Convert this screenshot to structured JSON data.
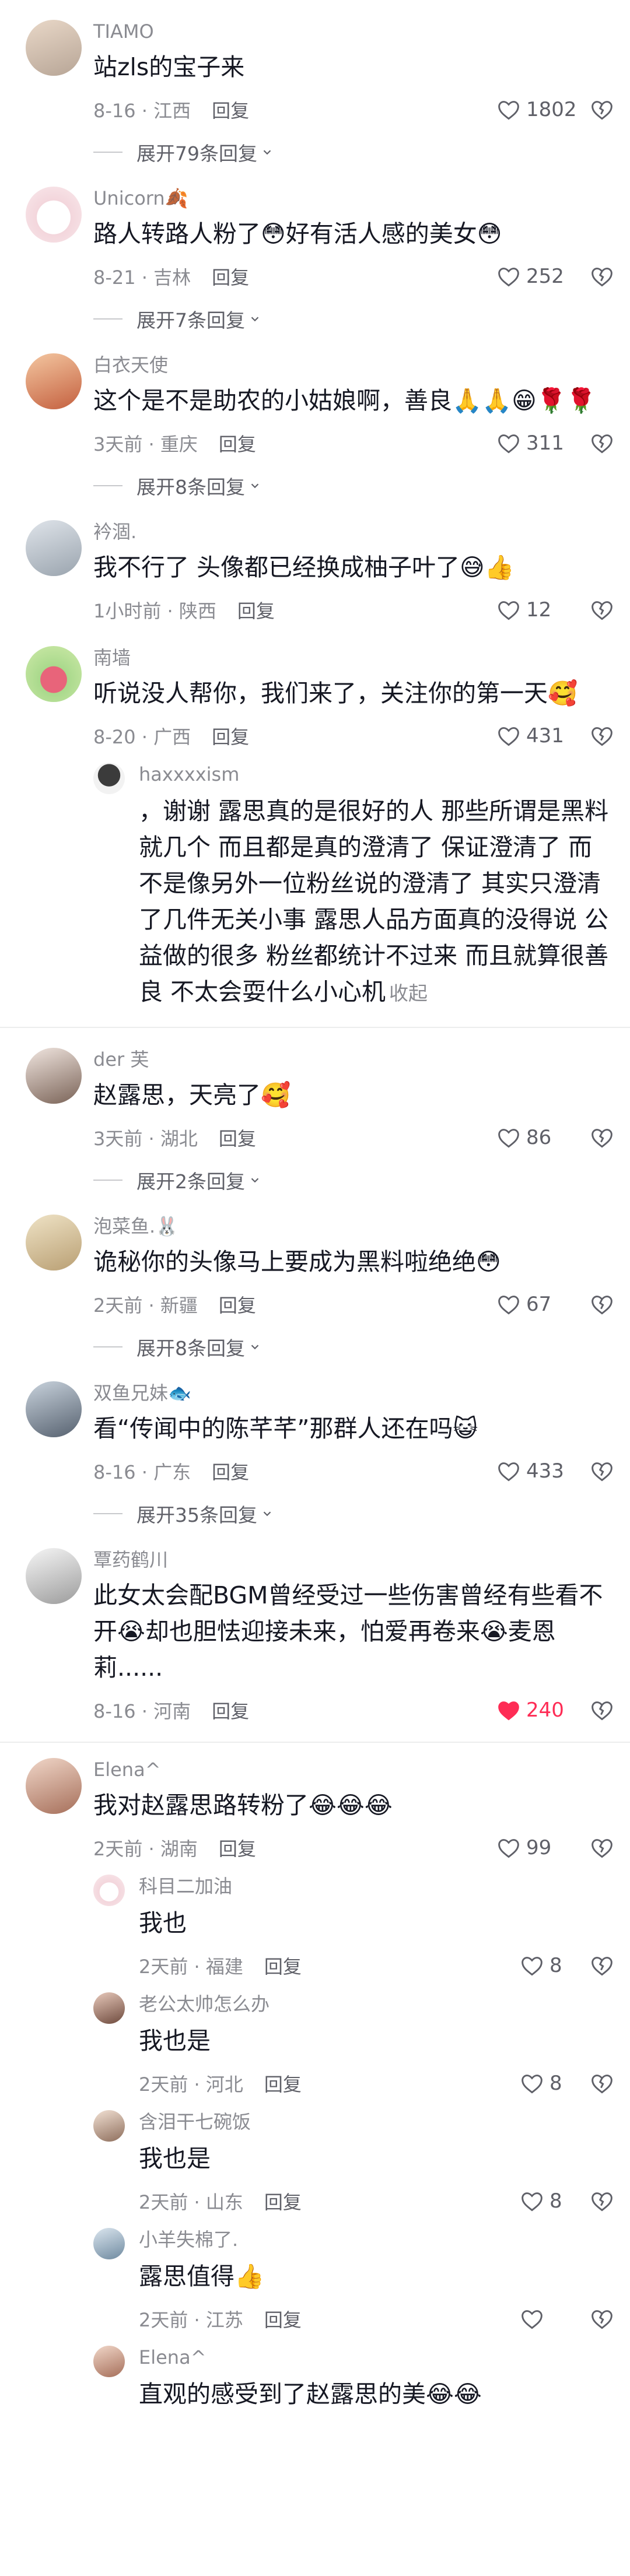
{
  "colors": {
    "accent": "#fe2c55",
    "muted": "#8a8b91",
    "text": "#161823"
  },
  "comments": [
    {
      "name": "TIAMO",
      "text": "站zls的宝子来",
      "date": "8-16 · 江西",
      "reply": "回复",
      "likes": "1802",
      "expand": "展开79条回复"
    },
    {
      "name": "Unicorn🍂",
      "text": "路人转路人粉了😳好有活人感的美女😳",
      "date": "8-21 · 吉林",
      "reply": "回复",
      "likes": "252",
      "expand": "展开7条回复"
    },
    {
      "name": "白衣天使",
      "text": "这个是不是助农的小姑娘啊，善良🙏🙏😁🌹🌹",
      "date": "3天前 · 重庆",
      "reply": "回复",
      "likes": "311",
      "expand": "展开8条回复"
    },
    {
      "name": "衿涸.",
      "text": "我不行了 头像都已经换成柚子叶了😅👍",
      "date": "1小时前 · 陕西",
      "reply": "回复",
      "likes": "12"
    },
    {
      "name": "南墙",
      "text": "听说没人帮你，我们来了，关注你的第一天🥰",
      "date": "8-20 · 广西",
      "reply": "回复",
      "likes": "431"
    },
    {
      "name": "haxxxxism",
      "text": "，谢谢 露思真的是很好的人 那些所谓是黑料就几个 而且都是真的澄清了 保证澄清了 而不是像另外一位粉丝说的澄清了 其实只澄清了几件无关小事 露思人品方面真的没得说 公益做的很多 粉丝都统计不过来 而且就算很善良 不太会耍什么小心机",
      "fold": "收起"
    },
    {
      "name": "der 芙",
      "text": "赵露思，天亮了🥰",
      "date": "3天前 · 湖北",
      "reply": "回复",
      "likes": "86",
      "expand": "展开2条回复"
    },
    {
      "name": "泡菜鱼.🐰",
      "text": "诡秘你的头像马上要成为黑料啦绝绝😳",
      "date": "2天前 · 新疆",
      "reply": "回复",
      "likes": "67",
      "expand": "展开8条回复"
    },
    {
      "name": "双鱼兄妹🐟",
      "text": "看“传闻中的陈芊芊”那群人还在吗😺",
      "date": "8-16 · 广东",
      "reply": "回复",
      "likes": "433",
      "expand": "展开35条回复"
    },
    {
      "name": "覃药鹤川",
      "text": "此女太会配BGM曾经受过一些伤害曾经有些看不开😭却也胆怯迎接未来，怕爱再卷来😭麦恩莉......",
      "date": "8-16 · 河南",
      "reply": "回复",
      "likes": "240"
    },
    {
      "name": "Elena^",
      "text": "我对赵露思路转粉了😂😂😂",
      "date": "2天前 · 湖南",
      "reply": "回复",
      "likes": "99"
    },
    {
      "name": "科目二加油",
      "text": "我也",
      "date": "2天前 · 福建",
      "reply": "回复",
      "likes": "8"
    },
    {
      "name": "老公太帅怎么办",
      "text": "我也是",
      "date": "2天前 · 河北",
      "reply": "回复",
      "likes": "8"
    },
    {
      "name": "含泪干七碗饭",
      "text": "我也是",
      "date": "2天前 · 山东",
      "reply": "回复",
      "likes": "8"
    },
    {
      "name": "小羊失棉了.",
      "text": "露思值得👍",
      "date": "2天前 · 江苏",
      "reply": "回复",
      "likes": ""
    },
    {
      "name": "Elena^",
      "text": "直观的感受到了赵露思的美😂😂"
    }
  ]
}
